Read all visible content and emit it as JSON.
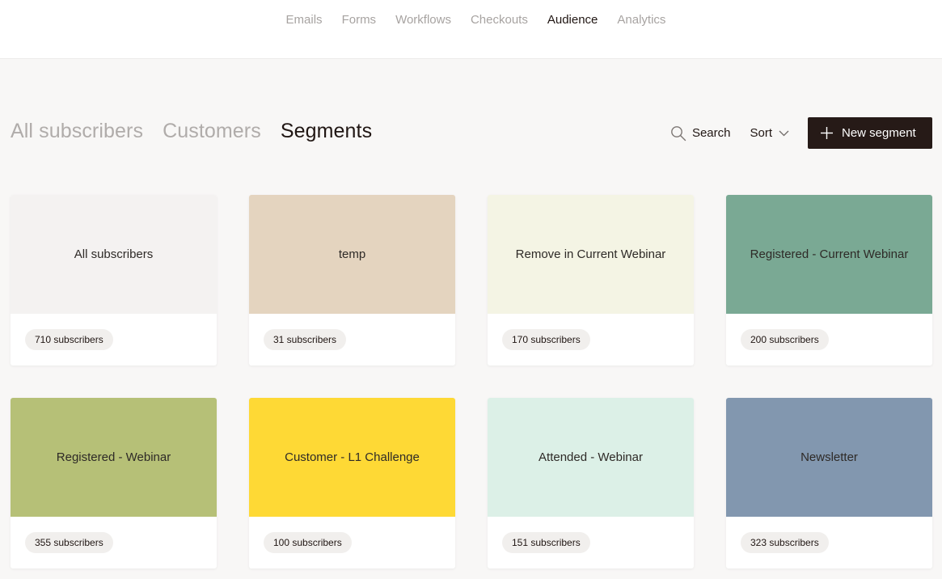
{
  "topnav": {
    "items": [
      {
        "label": "Emails",
        "active": false
      },
      {
        "label": "Forms",
        "active": false
      },
      {
        "label": "Workflows",
        "active": false
      },
      {
        "label": "Checkouts",
        "active": false
      },
      {
        "label": "Audience",
        "active": true
      },
      {
        "label": "Analytics",
        "active": false
      }
    ]
  },
  "subnav": {
    "items": [
      {
        "label": "All subscribers",
        "active": false
      },
      {
        "label": "Customers",
        "active": false
      },
      {
        "label": "Segments",
        "active": true
      }
    ]
  },
  "actions": {
    "search_label": "Search",
    "sort_label": "Sort",
    "new_label": "New segment"
  },
  "segments": [
    {
      "name": "All subscribers",
      "count": "710 subscribers",
      "color": "#f4f2f1"
    },
    {
      "name": "temp",
      "count": "31 subscribers",
      "color": "#e4d4bf"
    },
    {
      "name": "Remove in Current Webinar",
      "count": "170 subscribers",
      "color": "#f4f4e4"
    },
    {
      "name": "Registered - Current Webinar",
      "count": "200 subscribers",
      "color": "#7aa994"
    },
    {
      "name": "Registered - Webinar",
      "count": "355 subscribers",
      "color": "#b6c077"
    },
    {
      "name": "Customer - L1 Challenge",
      "count": "100 subscribers",
      "color": "#fed935"
    },
    {
      "name": "Attended - Webinar",
      "count": "151 subscribers",
      "color": "#dcf0e7"
    },
    {
      "name": "Newsletter",
      "count": "323 subscribers",
      "color": "#8297af"
    }
  ]
}
